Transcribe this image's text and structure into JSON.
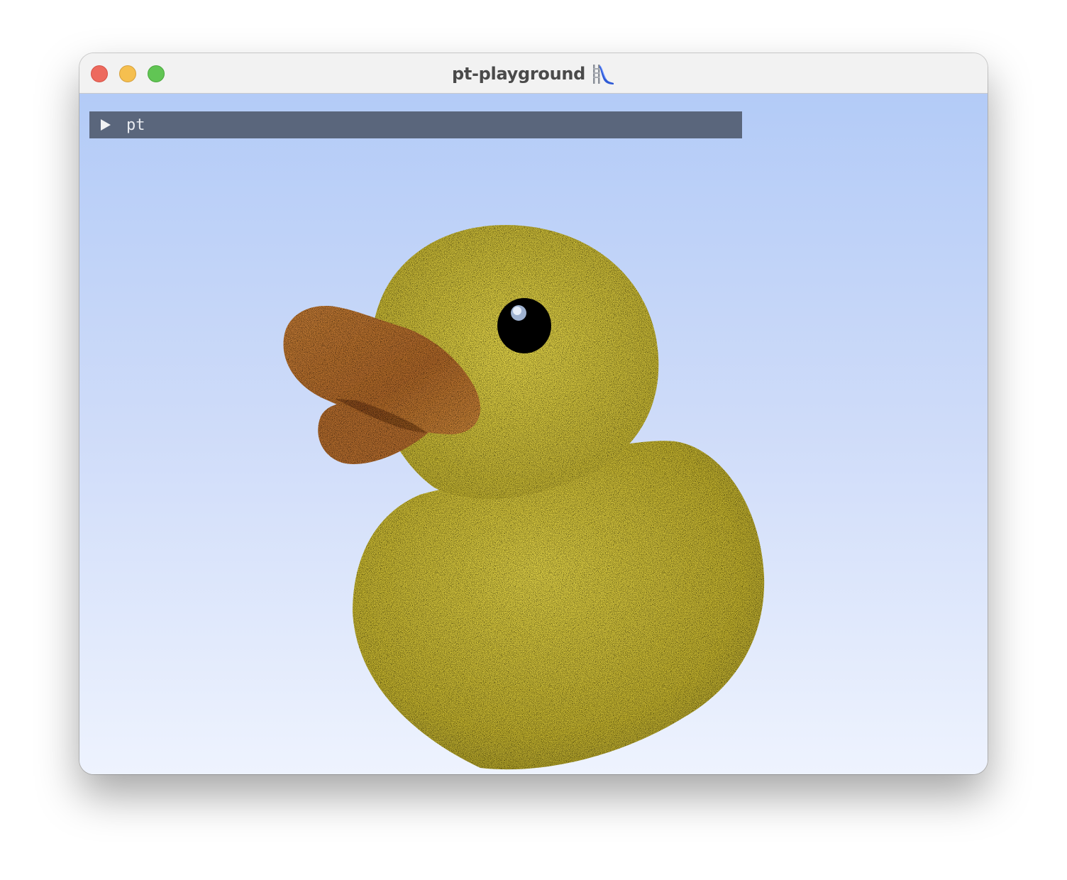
{
  "window": {
    "title": "pt-playground",
    "title_icon": "playground-slide-icon"
  },
  "gui_panel": {
    "label": "pt",
    "toggle_icon": "triangle-right-icon",
    "state": "collapsed"
  },
  "scene": {
    "object": "rubber-duck",
    "colors": {
      "sky_top": "#b3cbf7",
      "sky_bottom": "#eef3fe",
      "duck_body": "#d9c83a",
      "duck_beak": "#c47a35",
      "duck_eye": "#000000"
    }
  }
}
